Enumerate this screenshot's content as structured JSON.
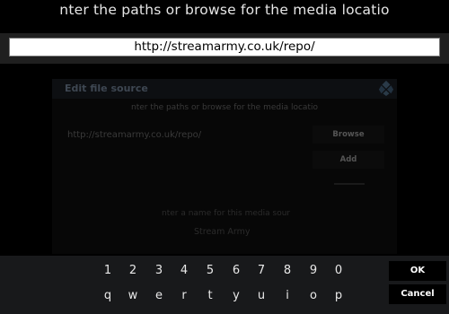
{
  "prompt": "nter the paths or browse for the media locatio",
  "input": {
    "value": "http://streamarmy.co.uk/repo/"
  },
  "background_dialog": {
    "title": "Edit file source",
    "subtitle": "nter the paths or browse for the media locatio",
    "path": "http://streamarmy.co.uk/repo/",
    "browse_label": "Browse",
    "add_label": "Add",
    "name_label": "nter a name for this media sour",
    "name_value": "Stream Army"
  },
  "keyboard": {
    "digits": [
      "1",
      "2",
      "3",
      "4",
      "5",
      "6",
      "7",
      "8",
      "9",
      "0"
    ],
    "letters": [
      "q",
      "w",
      "e",
      "r",
      "t",
      "y",
      "u",
      "i",
      "o",
      "p"
    ],
    "ok_label": "OK",
    "cancel_label": "Cancel"
  }
}
